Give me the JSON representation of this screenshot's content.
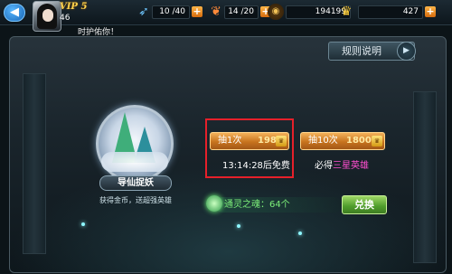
{
  "topbar": {
    "back_glyph": "◀",
    "vip": "VIP 5",
    "level": "46",
    "stamina": {
      "icon": "feather-icon",
      "value": "10 /40",
      "plus": "+"
    },
    "energy": {
      "icon": "dragon-icon",
      "value": "14 /20",
      "plus": "+"
    },
    "gold": {
      "icon": "coin-icon",
      "value": "194199"
    },
    "gems": {
      "icon": "crown-icon",
      "value": "427",
      "plus": "+"
    }
  },
  "notice": "时护佑你！",
  "panel": {
    "help_label": "规则说明",
    "help_arrow": "▶",
    "emblem": {
      "title": "导仙捉妖",
      "subtitle": "获得金币，送超强英雄"
    },
    "single_draw": {
      "label": "抽1次",
      "cost": "198",
      "currency_icon": "crown-icon"
    },
    "timer": "13:14:28后免费",
    "ten_draw": {
      "label": "抽10次",
      "cost": "1800",
      "currency_icon": "crown-icon"
    },
    "guarantee": {
      "prefix": "必得",
      "hero": "三星英雄"
    },
    "spirit": {
      "label": "通灵之魂：64个"
    },
    "exchange_label": "兑换"
  },
  "colors": {
    "accent_orange": "#c7731e",
    "highlight_red": "#e6202a",
    "spirit_green": "#7df07a",
    "hero_pink": "#ff4fd0"
  }
}
